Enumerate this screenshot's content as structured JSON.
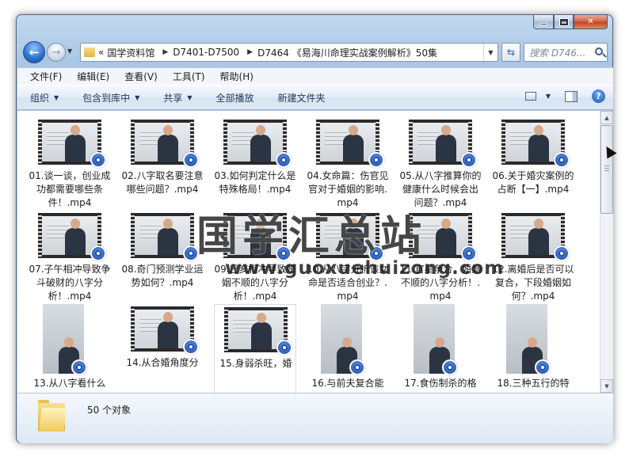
{
  "nav": {
    "address_parts": [
      "国学资料馆",
      "D7401-D7500",
      "D7464 《易海川命理实战案例解析》50集"
    ],
    "address_prefix": "«",
    "search_placeholder": "搜索 D746..."
  },
  "menu": [
    "文件(F)",
    "编辑(E)",
    "查看(V)",
    "工具(T)",
    "帮助(H)"
  ],
  "toolbar": {
    "organize": "组织",
    "include": "包含到库中",
    "share": "共享",
    "play_all": "全部播放",
    "new_folder": "新建文件夹"
  },
  "files": [
    {
      "label": "01.谈一谈，创业成功都需要哪些条件！.mp4",
      "thumb": "wide"
    },
    {
      "label": "02.八字取名要注意哪些问题？.mp4",
      "thumb": "wide"
    },
    {
      "label": "03.如何判定什么是特殊格局！.mp4",
      "thumb": "wide"
    },
    {
      "label": "04.女命篇：伤官见官对于婚姻的影响.mp4",
      "thumb": "wide"
    },
    {
      "label": "05.从八字推算你的健康什么时候会出问题？.mp4",
      "thumb": "wide"
    },
    {
      "label": "06.关于婚灾案例的占断【一】.mp4",
      "thumb": "wide"
    },
    {
      "label": "07.子午相冲导致争斗破财的八字分析！.mp4",
      "thumb": "wide"
    },
    {
      "label": "08.奇门预测学业运势如何？.mp4",
      "thumb": "wide"
    },
    {
      "label": "09.巳亥相冲导致婚姻不顺的八字分析！.mp4",
      "thumb": "wide"
    },
    {
      "label": "10.从八字分析该女命是否适合创业？.mp4",
      "thumb": "wide"
    },
    {
      "label": "11.官星争合，婚姻不顺的八字分析！.mp4",
      "thumb": "wide"
    },
    {
      "label": "12.离婚后是否可以复合，下段婚姻如何？.mp4",
      "thumb": "wide"
    },
    {
      "label": "13.从八字看什么",
      "thumb": "tall"
    },
    {
      "label": "14.从合婚角度分",
      "thumb": "wide"
    },
    {
      "label": "15.身弱杀旺，婚",
      "thumb": "wide"
    },
    {
      "label": "16.与前夫复合能",
      "thumb": "tall"
    },
    {
      "label": "17.食伤制杀的格",
      "thumb": "tall"
    },
    {
      "label": "18.三种五行的特",
      "thumb": "tall"
    }
  ],
  "watermark": {
    "title": "国学汇总站",
    "url": "www.guoxuehuizong.com"
  },
  "status": {
    "count_text": "50 个对象"
  }
}
